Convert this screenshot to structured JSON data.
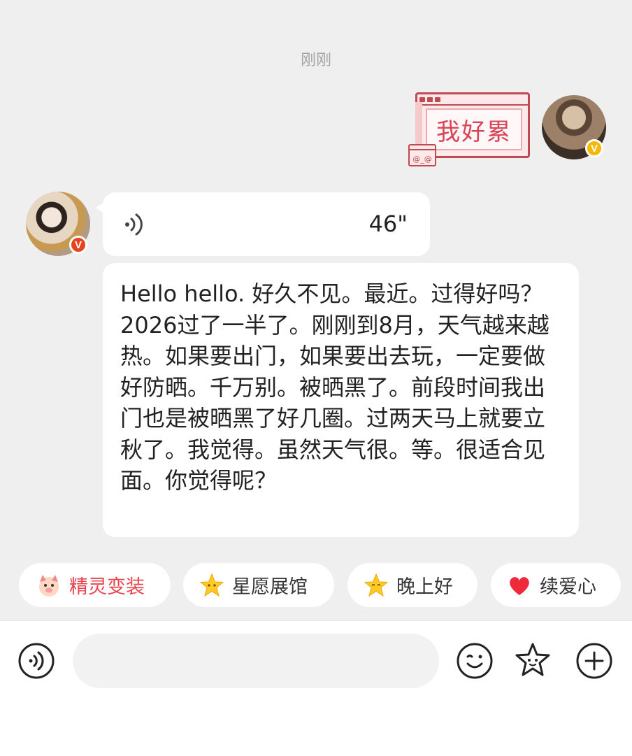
{
  "chat": {
    "timestamp": "刚刚",
    "outgoing_sticker": {
      "text": "我好累",
      "face_text": "@_@"
    },
    "voice_message": {
      "duration": "46\""
    },
    "text_message": "Hello hello. 好久不见。最近。过得好吗？2026过了一半了。刚刚到8月，天气越来越热。如果要出门，如果要出去玩，一定要做好防晒。千万别。被晒黑了。前段时间我出门也是被晒黑了好几圈。过两天马上就要立秋了。我觉得。虽然天气很。等。很适合见面。你觉得呢？"
  },
  "badges": {
    "me": "V",
    "them": "V"
  },
  "quick_chips": [
    {
      "label": "精灵变装",
      "icon": "pig-face-icon",
      "color": "#e8434f"
    },
    {
      "label": "星愿展馆",
      "icon": "star-icon"
    },
    {
      "label": "晚上好",
      "icon": "star-icon"
    },
    {
      "label": "续爱心",
      "icon": "heart-icon"
    }
  ],
  "input": {
    "placeholder": ""
  },
  "colors": {
    "background": "#efefef",
    "bubble": "#ffffff",
    "accent_red": "#e8434f",
    "badge_yellow": "#f5b700"
  }
}
